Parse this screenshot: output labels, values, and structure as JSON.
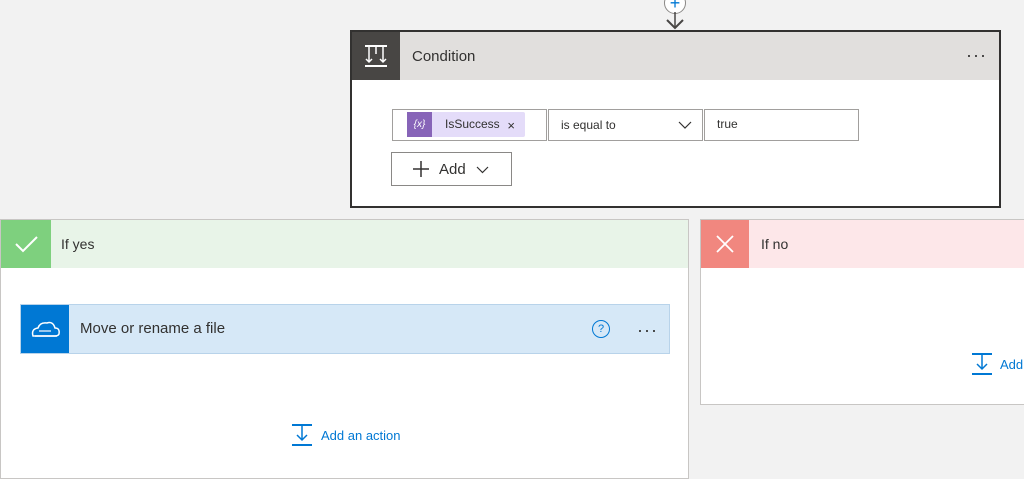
{
  "condition": {
    "title": "Condition",
    "more_label": "···",
    "token": {
      "label": "IsSuccess",
      "icon_text": "{x}",
      "remove": "×"
    },
    "operator": "is equal to",
    "value": "true",
    "add_label": "Add"
  },
  "branches": {
    "yes": {
      "title": "If yes",
      "action": {
        "title": "Move or rename a file",
        "help": "?",
        "more_label": "···"
      },
      "add_action_label": "Add an action"
    },
    "no": {
      "title": "If no",
      "add_action_label": "Add"
    }
  },
  "colors": {
    "accent": "#0078d4",
    "yes": "#7ed07e",
    "no": "#f1877f",
    "token": "#8764b8"
  },
  "icons": [
    "plus-icon",
    "condition-icon",
    "variable-icon",
    "close-icon",
    "chevron-down-icon",
    "check-icon",
    "x-icon",
    "onedrive-icon",
    "help-icon",
    "add-action-icon"
  ]
}
